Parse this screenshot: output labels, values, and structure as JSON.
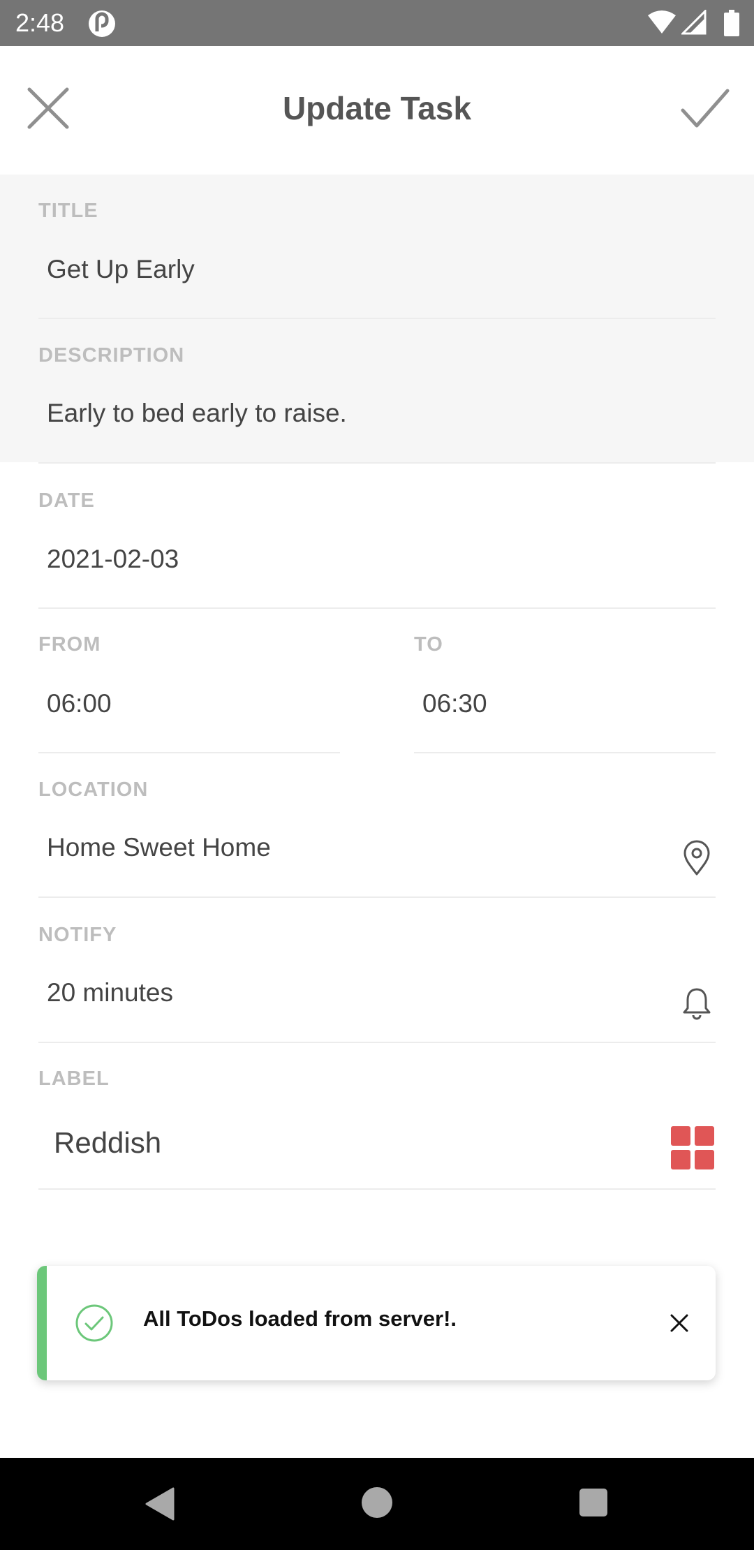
{
  "status_bar": {
    "time": "2:48",
    "app_icon": "app-notification-icon",
    "right_icons": [
      "wifi-icon",
      "cell-signal-icon",
      "battery-icon"
    ]
  },
  "app_bar": {
    "title": "Update Task",
    "close_icon": "close-icon",
    "confirm_icon": "check-icon"
  },
  "form": {
    "title": {
      "label": "TITLE",
      "value": "Get Up Early"
    },
    "description": {
      "label": "DESCRIPTION",
      "value": "Early to bed early to raise."
    },
    "date": {
      "label": "DATE",
      "value": "2021-02-03"
    },
    "from": {
      "label": "FROM",
      "value": "06:00"
    },
    "to": {
      "label": "TO",
      "value": "06:30"
    },
    "location": {
      "label": "LOCATION",
      "value": "Home Sweet Home",
      "icon": "location-pin-icon"
    },
    "notify": {
      "label": "NOTIFY",
      "value": "20 minutes",
      "icon": "bell-icon"
    },
    "label": {
      "label": "LABEL",
      "value": "Reddish",
      "icon": "color-grid-icon",
      "color": "#e05656"
    }
  },
  "toast": {
    "message": "All ToDos loaded from server!.",
    "accent_color": "#6cc77a",
    "icon": "check-circle-icon",
    "close_icon": "close-icon"
  },
  "nav_bar": {
    "icons": [
      "back-icon",
      "home-icon",
      "recents-icon"
    ]
  }
}
